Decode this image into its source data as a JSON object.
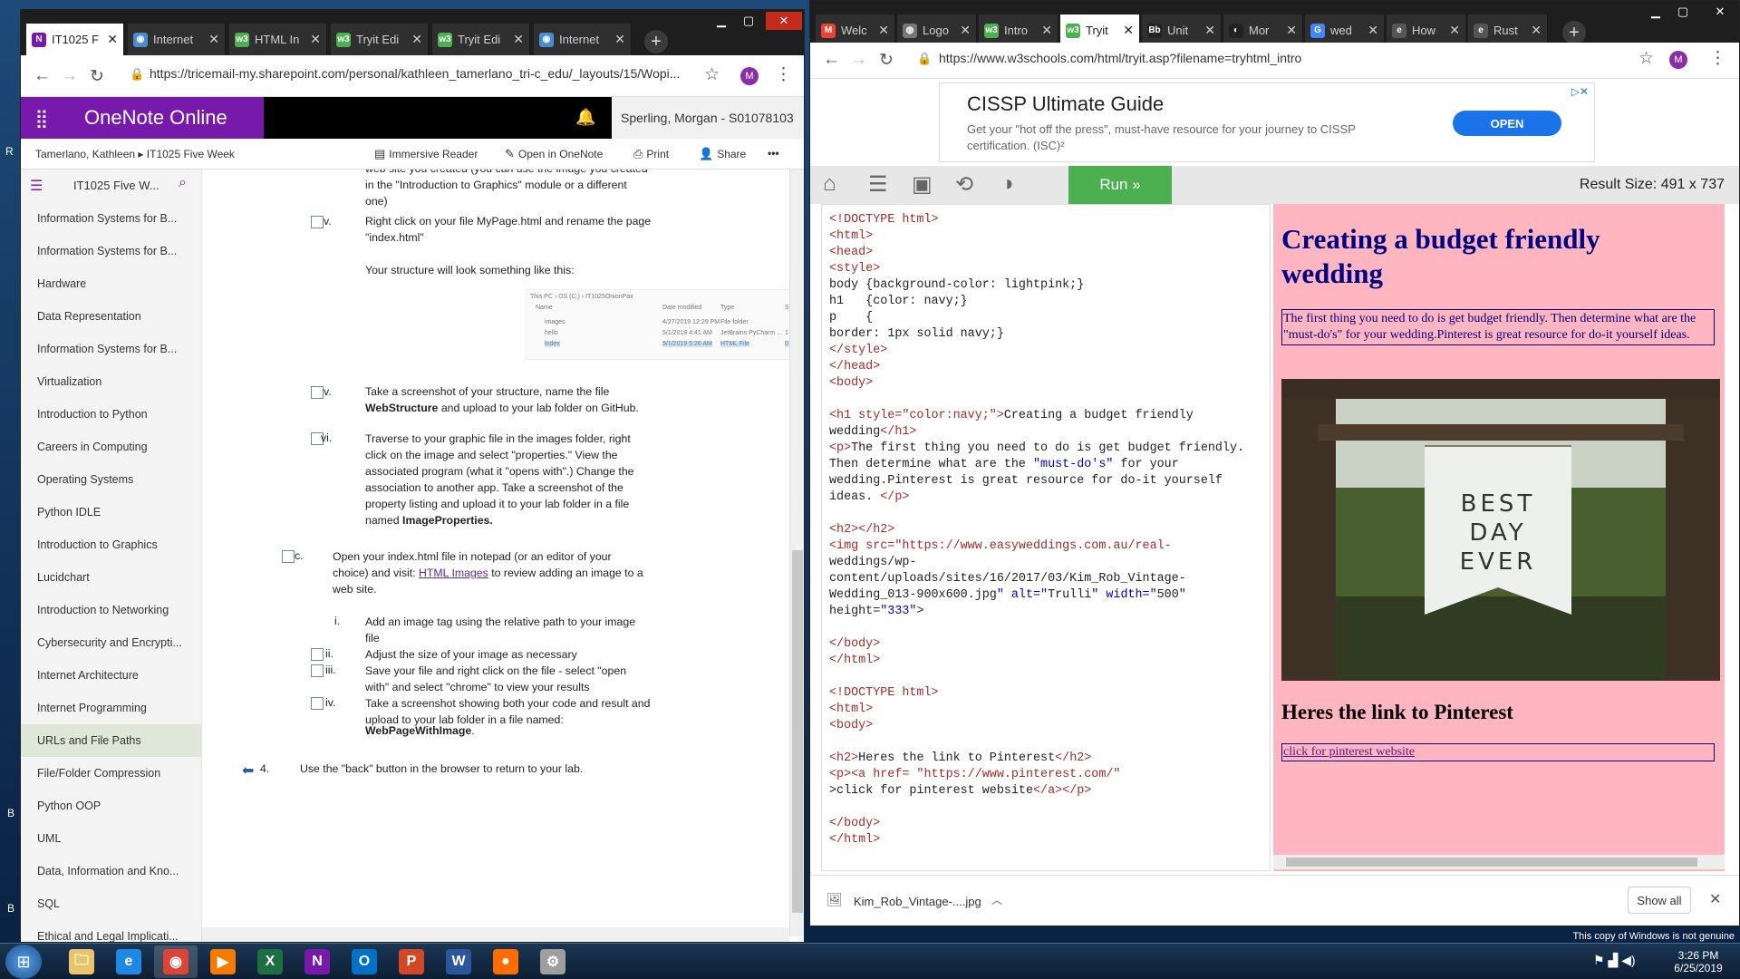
{
  "desktop": {
    "edge_letters": [
      "R",
      "B",
      "B"
    ],
    "watermark": "This copy of Windows is not genuine"
  },
  "left_browser": {
    "tabs": [
      {
        "label": "IT1025 F",
        "icon": "onenote-icon",
        "color": "#7719aa",
        "glyph": "N"
      },
      {
        "label": "Internet",
        "icon": "globe-icon",
        "color": "#4a8bd6",
        "glyph": "◉"
      },
      {
        "label": "HTML In",
        "icon": "w3schools-icon",
        "color": "#4caf50",
        "glyph": "w3"
      },
      {
        "label": "Tryit Edi",
        "icon": "w3schools-icon",
        "color": "#4caf50",
        "glyph": "w3"
      },
      {
        "label": "Tryit Edi",
        "icon": "w3schools-icon",
        "color": "#4caf50",
        "glyph": "w3"
      },
      {
        "label": "Internet",
        "icon": "globe-icon",
        "color": "#4a8bd6",
        "glyph": "◉"
      }
    ],
    "url": "https://tricemail-my.sharepoint.com/personal/kathleen_tamerlano_tri-c_edu/_layouts/15/Wopi...",
    "avatar": "M",
    "app_name": "OneNote Online",
    "user": "Sperling, Morgan - S01078103",
    "breadcrumb": [
      "Tamerlano, Kathleen",
      "IT1025 Five Week"
    ],
    "ribbon": [
      "Immersive Reader",
      "Open in OneNote",
      "Print",
      "Share",
      "•••"
    ],
    "notebook": "IT1025 Five W...",
    "sections": [
      "Information Systems for B...",
      "Information Systems for B...",
      "Hardware",
      "Data Representation",
      "Information Systems for B...",
      "Virtualization",
      "Introduction to Python",
      "Careers in Computing",
      "Operating Systems",
      "Python IDLE",
      "Introduction to Graphics",
      "Lucidchart",
      "Introduction to Networking",
      "Cybersecurity and Encrypti...",
      "Internet Architecture",
      "Internet Programming",
      "URLs and File Paths",
      "File/Folder Compression",
      "Python OOP",
      "UML",
      "Data, Information and Kno...",
      "SQL",
      "Ethical and Legal Implicati..."
    ],
    "selected_section": 16,
    "page": {
      "top_partial": "web site you created (you can use the image you created",
      "top_l2": "in the \"Introduction to Graphics\" module or a different",
      "top_l3": "one)",
      "iv_num": "v.",
      "iv_l1": "Right click on your file MyPage.html and rename the page",
      "iv_l2": "\"index.html\"",
      "structure": "Your structure will look something like this:",
      "thumb": {
        "path": "This PC  ›  OS (C:)  ›  IT1025OnionPax",
        "cols": [
          "Name",
          "Date modified",
          "Type",
          "Size"
        ],
        "rows": [
          [
            "images",
            "4/27/2019 12:29 PM",
            "File folder",
            ""
          ],
          [
            "hello",
            "5/1/2019 4:41 AM",
            "JetBrains PyCharm ...",
            "1 KB"
          ],
          [
            "index",
            "5/1/2019 5:26 AM",
            "HTML File",
            "0 KB"
          ]
        ]
      },
      "v_num": "v.",
      "v_l1": "Take a screenshot of your structure, name the file",
      "v_bold": "WebStructure",
      "v_l2": " and upload to your lab folder on GitHub.",
      "vi_num": "vi.",
      "vi_lines": [
        "Traverse to your graphic file in the images folder, right",
        "click on the image and select \"properties.\" View the",
        "associated program (what it \"opens with\".)  Change the",
        "association to another app. Take a screenshot of the",
        "property listing and upload it to your lab folder in a file"
      ],
      "vi_last_pre": "named ",
      "vi_bold": "ImageProperties.",
      "c_num": "c.",
      "c_l1": "Open your index.html file in notepad (or an editor of your",
      "c_l2_pre": "choice) and visit: ",
      "c_link": "HTML Images",
      "c_l2_post": " to review adding an image to a",
      "c_l3": "web site.",
      "sub": [
        {
          "num": "i.",
          "lines": [
            "Add an image tag using the relative path to your image",
            "file"
          ]
        },
        {
          "num": "ii.",
          "lines": [
            "Adjust the size of your image as necessary"
          ]
        },
        {
          "num": "iii.",
          "lines": [
            "Save your file and right click on the file - select \"open",
            "with\" and select \"chrome\" to view your results"
          ]
        },
        {
          "num": "iv.",
          "lines": [
            "Take a screenshot showing both your code and result and",
            "upload to your lab folder in a file named:"
          ]
        }
      ],
      "iv_bold": "WebPageWithImage",
      "iv_dot": ".",
      "step4_num": "4.",
      "step4": "Use the \"back\" button in the browser to return to your lab."
    }
  },
  "right_browser": {
    "tabs": [
      {
        "label": "Welc",
        "color": "#ea4335",
        "glyph": "M"
      },
      {
        "label": "Logo",
        "color": "#777",
        "glyph": "◍"
      },
      {
        "label": "Intro",
        "color": "#4caf50",
        "glyph": "w3"
      },
      {
        "label": "Tryit",
        "color": "#4caf50",
        "glyph": "w3"
      },
      {
        "label": "Unit",
        "color": "#222",
        "glyph": "Bb"
      },
      {
        "label": "Mor",
        "color": "#222",
        "glyph": "◐"
      },
      {
        "label": "wed",
        "color": "#4285f4",
        "glyph": "G"
      },
      {
        "label": "How",
        "color": "#555",
        "glyph": "e"
      },
      {
        "label": "Rust",
        "color": "#555",
        "glyph": "e"
      }
    ],
    "url": "https://www.w3schools.com/html/tryit.asp?filename=tryhtml_intro",
    "avatar": "M",
    "ad": {
      "title": "CISSP Ultimate Guide",
      "text": "Get your \"hot off the press\", must-have resource for your journey to CISSP certification. (ISC)²",
      "button": "OPEN"
    },
    "run_label": "Run »",
    "result_size": "Result Size: 491 x 737",
    "code_lines": [
      "<!DOCTYPE html>",
      "<html>",
      "<head>",
      "<style>",
      "body {background-color: lightpink;}",
      "h1   {color: navy;}",
      "p    {",
      "border: 1px solid navy;}",
      "</style>",
      "</head>",
      "<body>",
      "",
      "<h1 style=\"color:navy;\">Creating a budget friendly",
      "wedding</h1>",
      "<p>The first thing you need to do is get budget friendly.",
      "Then determine what are the \"must-do's\" for your",
      "wedding.Pinterest is great resource for do-it yourself",
      "ideas. </p>",
      "",
      "<h2></h2>",
      "<img src=\"https://www.easyweddings.com.au/real-",
      "weddings/wp-",
      "content/uploads/sites/16/2017/03/Kim_Rob_Vintage-",
      "Wedding_013-900x600.jpg\" alt=\"Trulli\" width=\"500\"",
      "height=\"333\">",
      "",
      "</body>",
      "</html>",
      "",
      "<!DOCTYPE html>",
      "<html>",
      "<body>",
      "",
      "<h2>Heres the link to Pinterest</h2>",
      "<p><a href= \"https://www.pinterest.com/\"",
      ">click for pinterest website</a></p>",
      "",
      "</body>",
      "</html>"
    ],
    "result": {
      "h1": "Creating a budget friendly wedding",
      "p": "The first thing you need to do is get budget friendly. Then determine what are the \"must-do's\" for your wedding.Pinterest is great resource for do-it yourself ideas.",
      "banner": [
        "BEST",
        "DAY",
        "EVER"
      ],
      "h2": "Heres the link to Pinterest",
      "link": "click for pinterest website"
    },
    "download": {
      "file": "Kim_Rob_Vintage-....jpg",
      "show_all": "Show all"
    }
  },
  "taskbar": {
    "apps": [
      {
        "name": "explorer-icon",
        "glyph": "🗀",
        "color": "#e9c46a"
      },
      {
        "name": "ie-icon",
        "glyph": "e",
        "color": "#1e88e5"
      },
      {
        "name": "chrome-icon",
        "glyph": "◉",
        "color": "#db4437"
      },
      {
        "name": "media-player-icon",
        "glyph": "▶",
        "color": "#f57c00"
      },
      {
        "name": "excel-icon",
        "glyph": "X",
        "color": "#1d6f42"
      },
      {
        "name": "onenote-icon",
        "glyph": "N",
        "color": "#7719aa"
      },
      {
        "name": "outlook-icon",
        "glyph": "O",
        "color": "#0072c6"
      },
      {
        "name": "powerpoint-icon",
        "glyph": "P",
        "color": "#d24726"
      },
      {
        "name": "word-icon",
        "glyph": "W",
        "color": "#2b579a"
      },
      {
        "name": "media-icon",
        "glyph": "●",
        "color": "#ff6d00"
      },
      {
        "name": "tools-icon",
        "glyph": "⚙",
        "color": "#9e9e9e"
      }
    ],
    "time": "3:26 PM",
    "date": "6/25/2019"
  }
}
